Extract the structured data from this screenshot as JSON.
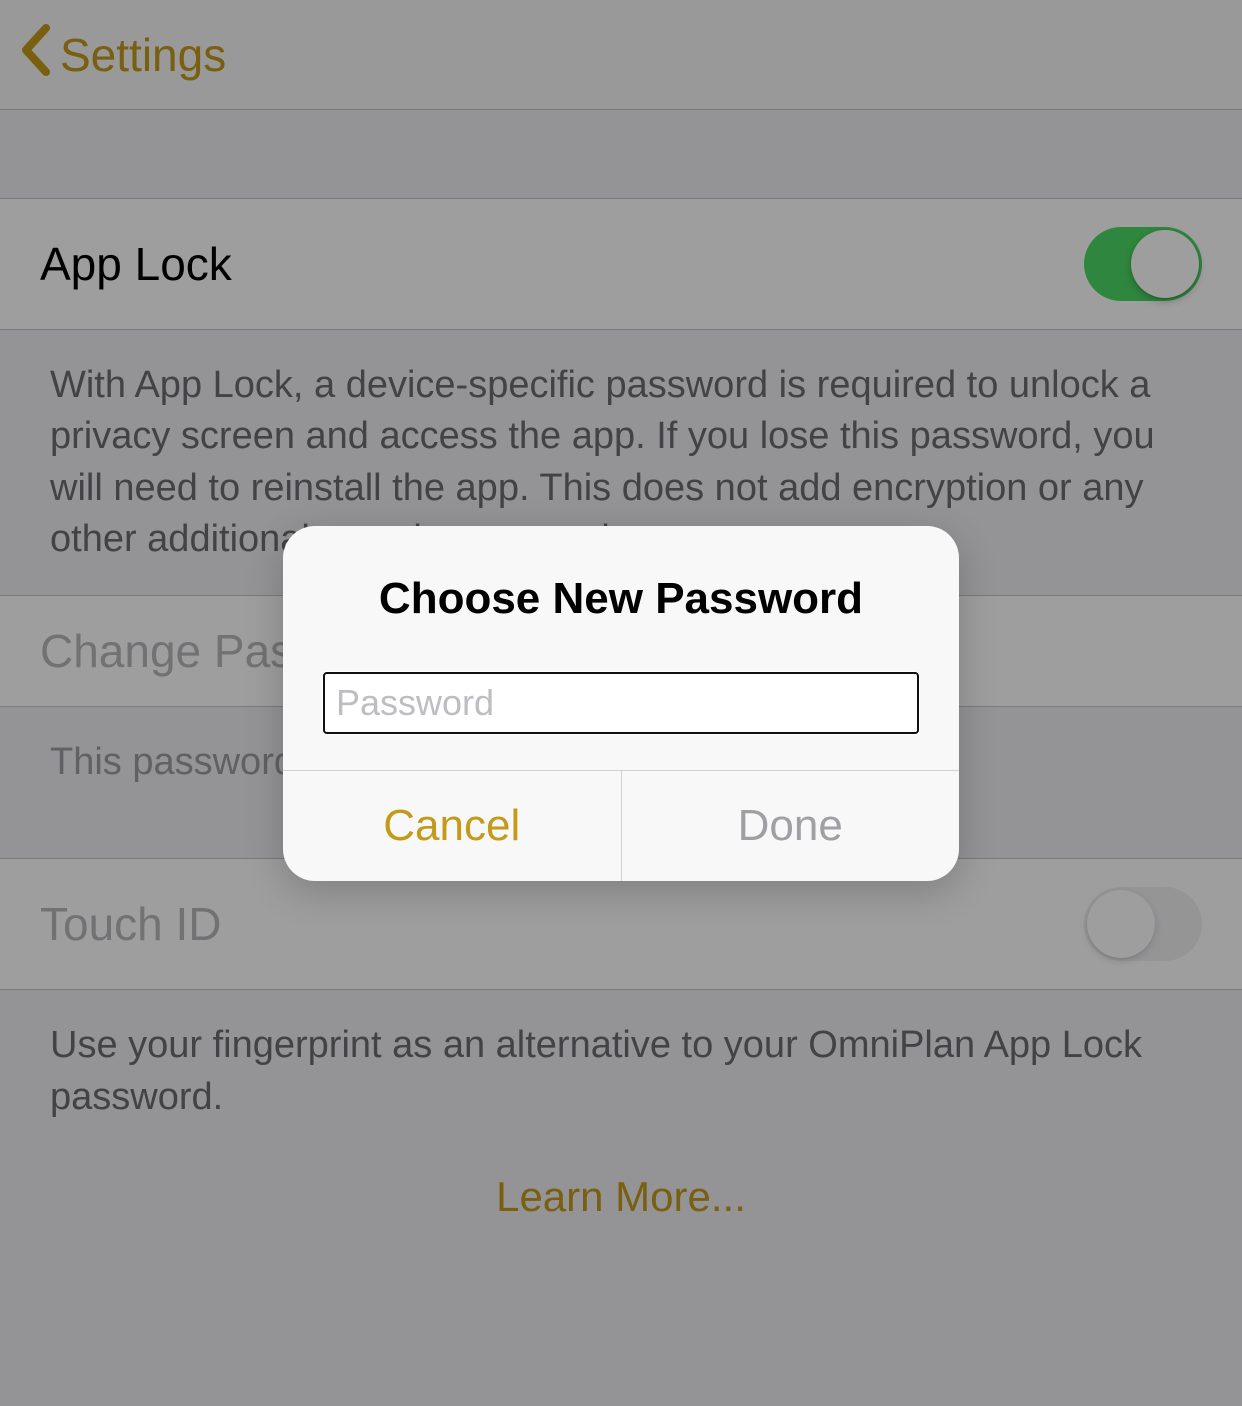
{
  "nav": {
    "back_label": "Settings"
  },
  "sections": {
    "app_lock": {
      "label": "App Lock",
      "toggle_on": true,
      "description": "With App Lock, a device-specific password is required to unlock a privacy screen and access the app. If you lose this password, you will need to reinstall the app. This does not add encryption or any other additional security to your documents."
    },
    "change_password": {
      "label": "Change Password",
      "footer": "This password is required to open OmniPlan."
    },
    "touch_id": {
      "label": "Touch ID",
      "toggle_on": false,
      "description": "Use your fingerprint as an alternative to your OmniPlan App Lock password."
    },
    "learn_more_label": "Learn More..."
  },
  "alert": {
    "title": "Choose New Password",
    "input_placeholder": "Password",
    "input_value": "",
    "cancel_label": "Cancel",
    "done_label": "Done"
  },
  "colors": {
    "accent": "#c49a1b",
    "switch_on": "#4cd964"
  }
}
